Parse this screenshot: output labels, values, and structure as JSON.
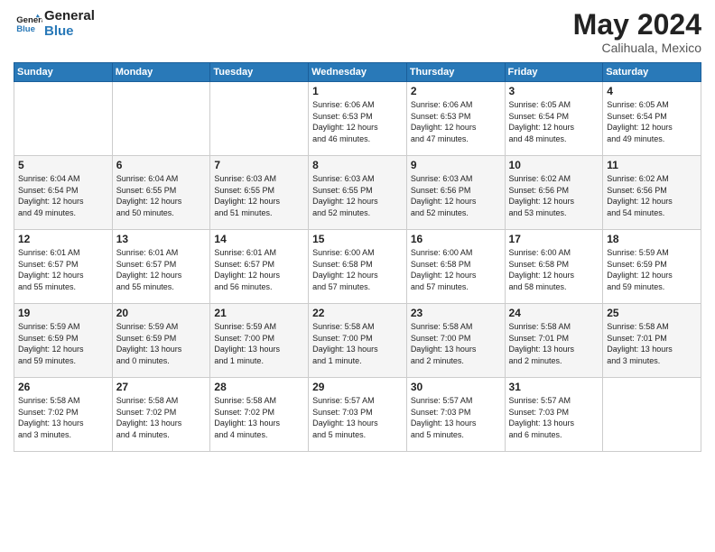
{
  "logo": {
    "line1": "General",
    "line2": "Blue"
  },
  "title": "May 2024",
  "subtitle": "Calihuala, Mexico",
  "days_header": [
    "Sunday",
    "Monday",
    "Tuesday",
    "Wednesday",
    "Thursday",
    "Friday",
    "Saturday"
  ],
  "weeks": [
    [
      {
        "day": "",
        "info": ""
      },
      {
        "day": "",
        "info": ""
      },
      {
        "day": "",
        "info": ""
      },
      {
        "day": "1",
        "info": "Sunrise: 6:06 AM\nSunset: 6:53 PM\nDaylight: 12 hours\nand 46 minutes."
      },
      {
        "day": "2",
        "info": "Sunrise: 6:06 AM\nSunset: 6:53 PM\nDaylight: 12 hours\nand 47 minutes."
      },
      {
        "day": "3",
        "info": "Sunrise: 6:05 AM\nSunset: 6:54 PM\nDaylight: 12 hours\nand 48 minutes."
      },
      {
        "day": "4",
        "info": "Sunrise: 6:05 AM\nSunset: 6:54 PM\nDaylight: 12 hours\nand 49 minutes."
      }
    ],
    [
      {
        "day": "5",
        "info": "Sunrise: 6:04 AM\nSunset: 6:54 PM\nDaylight: 12 hours\nand 49 minutes."
      },
      {
        "day": "6",
        "info": "Sunrise: 6:04 AM\nSunset: 6:55 PM\nDaylight: 12 hours\nand 50 minutes."
      },
      {
        "day": "7",
        "info": "Sunrise: 6:03 AM\nSunset: 6:55 PM\nDaylight: 12 hours\nand 51 minutes."
      },
      {
        "day": "8",
        "info": "Sunrise: 6:03 AM\nSunset: 6:55 PM\nDaylight: 12 hours\nand 52 minutes."
      },
      {
        "day": "9",
        "info": "Sunrise: 6:03 AM\nSunset: 6:56 PM\nDaylight: 12 hours\nand 52 minutes."
      },
      {
        "day": "10",
        "info": "Sunrise: 6:02 AM\nSunset: 6:56 PM\nDaylight: 12 hours\nand 53 minutes."
      },
      {
        "day": "11",
        "info": "Sunrise: 6:02 AM\nSunset: 6:56 PM\nDaylight: 12 hours\nand 54 minutes."
      }
    ],
    [
      {
        "day": "12",
        "info": "Sunrise: 6:01 AM\nSunset: 6:57 PM\nDaylight: 12 hours\nand 55 minutes."
      },
      {
        "day": "13",
        "info": "Sunrise: 6:01 AM\nSunset: 6:57 PM\nDaylight: 12 hours\nand 55 minutes."
      },
      {
        "day": "14",
        "info": "Sunrise: 6:01 AM\nSunset: 6:57 PM\nDaylight: 12 hours\nand 56 minutes."
      },
      {
        "day": "15",
        "info": "Sunrise: 6:00 AM\nSunset: 6:58 PM\nDaylight: 12 hours\nand 57 minutes."
      },
      {
        "day": "16",
        "info": "Sunrise: 6:00 AM\nSunset: 6:58 PM\nDaylight: 12 hours\nand 57 minutes."
      },
      {
        "day": "17",
        "info": "Sunrise: 6:00 AM\nSunset: 6:58 PM\nDaylight: 12 hours\nand 58 minutes."
      },
      {
        "day": "18",
        "info": "Sunrise: 5:59 AM\nSunset: 6:59 PM\nDaylight: 12 hours\nand 59 minutes."
      }
    ],
    [
      {
        "day": "19",
        "info": "Sunrise: 5:59 AM\nSunset: 6:59 PM\nDaylight: 12 hours\nand 59 minutes."
      },
      {
        "day": "20",
        "info": "Sunrise: 5:59 AM\nSunset: 6:59 PM\nDaylight: 13 hours\nand 0 minutes."
      },
      {
        "day": "21",
        "info": "Sunrise: 5:59 AM\nSunset: 7:00 PM\nDaylight: 13 hours\nand 1 minute."
      },
      {
        "day": "22",
        "info": "Sunrise: 5:58 AM\nSunset: 7:00 PM\nDaylight: 13 hours\nand 1 minute."
      },
      {
        "day": "23",
        "info": "Sunrise: 5:58 AM\nSunset: 7:00 PM\nDaylight: 13 hours\nand 2 minutes."
      },
      {
        "day": "24",
        "info": "Sunrise: 5:58 AM\nSunset: 7:01 PM\nDaylight: 13 hours\nand 2 minutes."
      },
      {
        "day": "25",
        "info": "Sunrise: 5:58 AM\nSunset: 7:01 PM\nDaylight: 13 hours\nand 3 minutes."
      }
    ],
    [
      {
        "day": "26",
        "info": "Sunrise: 5:58 AM\nSunset: 7:02 PM\nDaylight: 13 hours\nand 3 minutes."
      },
      {
        "day": "27",
        "info": "Sunrise: 5:58 AM\nSunset: 7:02 PM\nDaylight: 13 hours\nand 4 minutes."
      },
      {
        "day": "28",
        "info": "Sunrise: 5:58 AM\nSunset: 7:02 PM\nDaylight: 13 hours\nand 4 minutes."
      },
      {
        "day": "29",
        "info": "Sunrise: 5:57 AM\nSunset: 7:03 PM\nDaylight: 13 hours\nand 5 minutes."
      },
      {
        "day": "30",
        "info": "Sunrise: 5:57 AM\nSunset: 7:03 PM\nDaylight: 13 hours\nand 5 minutes."
      },
      {
        "day": "31",
        "info": "Sunrise: 5:57 AM\nSunset: 7:03 PM\nDaylight: 13 hours\nand 6 minutes."
      },
      {
        "day": "",
        "info": ""
      }
    ]
  ]
}
